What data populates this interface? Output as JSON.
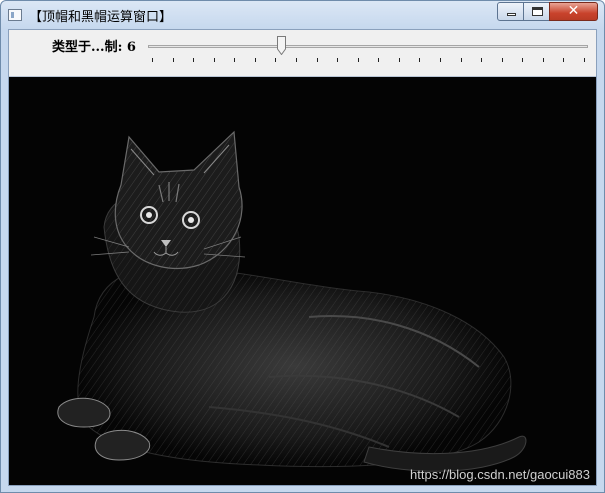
{
  "window": {
    "title": "【顶帽和黑帽运算窗口】",
    "controls": {
      "minimize": "minimize-icon",
      "maximize": "maximize-icon",
      "close": "close-icon"
    }
  },
  "toolbar": {
    "trackbar_label": "类型于...制: 6",
    "trackbar_value": 6,
    "trackbar_fraction": 0.3
  },
  "image": {
    "subject": "cat",
    "watermark": "https://blog.csdn.net/gaocui883"
  },
  "colors": {
    "titlebar": "#c6d8ee",
    "close_button": "#c9432c",
    "image_background": "#040404"
  }
}
